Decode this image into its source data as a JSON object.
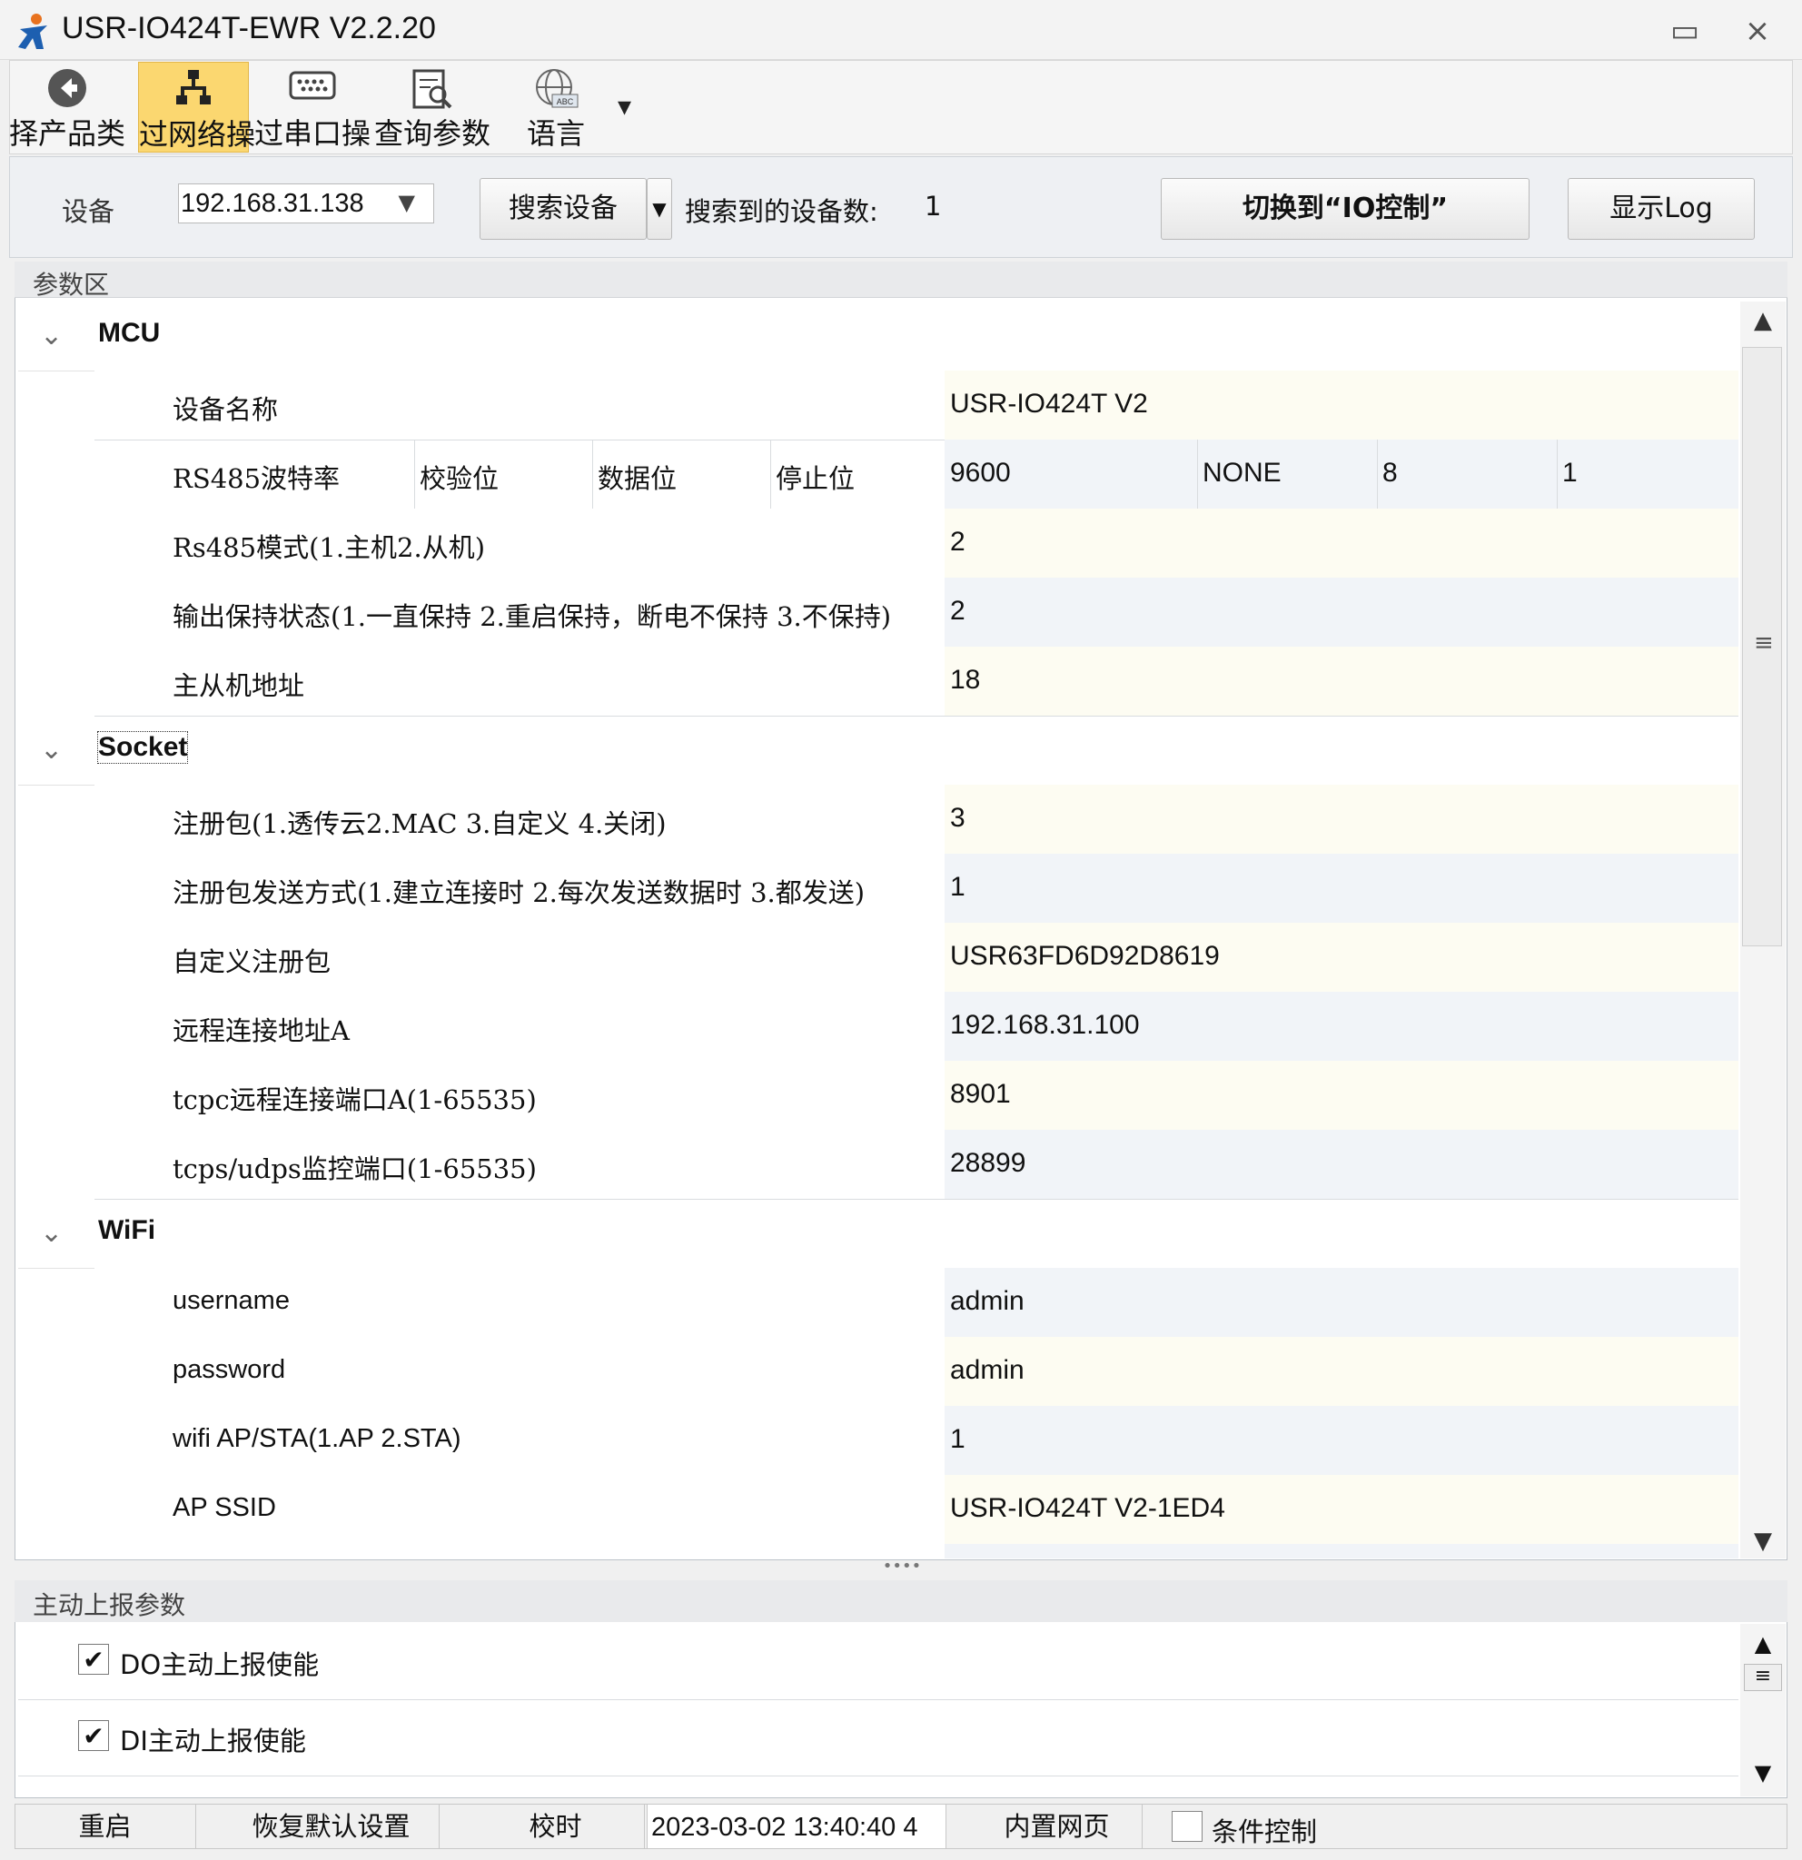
{
  "window": {
    "title": "USR-IO424T-EWR V2.2.20",
    "minimize_glyph": "▭",
    "close_glyph": "⨯"
  },
  "toolbar": {
    "items": [
      {
        "label": "择产品类",
        "icon": "back-arrow-icon"
      },
      {
        "label": "过网络操",
        "icon": "network-icon",
        "active": true
      },
      {
        "label": "过串口操",
        "icon": "serial-port-icon"
      },
      {
        "label": "查询参数",
        "icon": "query-params-icon"
      },
      {
        "label": "语言",
        "icon": "language-globe-icon"
      }
    ],
    "more_glyph": "▾"
  },
  "device_row": {
    "device_label": "设备",
    "device_ip": "192.168.31.138",
    "search_button": "搜索设备",
    "found_label": "搜索到的设备数:",
    "found_count": "1",
    "switch_button": "切换到“IO控制”",
    "log_button": "显示Log"
  },
  "params": {
    "header": "参数区",
    "mcu": {
      "title": "MCU",
      "device_name_label": "设备名称",
      "device_name_value": "USR-IO424T V2",
      "rs485": {
        "baud_label": "RS485波特率",
        "parity_label": "校验位",
        "databits_label": "数据位",
        "stopbits_label": "停止位",
        "baud": "9600",
        "parity": "NONE",
        "databits": "8",
        "stopbits": "1"
      },
      "mode_label": "Rs485模式(1.主机2.从机)",
      "mode_value": "2",
      "output_label": "输出保持状态(1.一直保持 2.重启保持，断电不保持 3.不保持)",
      "output_value": "2",
      "addr_label": "主从机地址",
      "addr_value": "18"
    },
    "socket": {
      "title": "Socket",
      "reg_label": "注册包(1.透传云2.MAC 3.自定义 4.关闭)",
      "reg_value": "3",
      "reg_send_label": "注册包发送方式(1.建立连接时 2.每次发送数据时 3.都发送)",
      "reg_send_value": "1",
      "custom_reg_label": "自定义注册包",
      "custom_reg_value": "USR63FD6D92D8619",
      "remote_addr_label": "远程连接地址A",
      "remote_addr_value": "192.168.31.100",
      "tcpc_port_label": "tcpc远程连接端口A(1-65535)",
      "tcpc_port_value": "8901",
      "listen_port_label": "tcps/udps监控端口(1-65535)",
      "listen_port_value": "28899"
    },
    "wifi": {
      "title": "WiFi",
      "username_label": "username",
      "username_value": "admin",
      "password_label": "password",
      "password_value": "admin",
      "mode_label": "wifi AP/STA(1.AP 2.STA)",
      "mode_value": "1",
      "ssid_label": "AP SSID",
      "ssid_value": "USR-IO424T V2-1ED4"
    }
  },
  "report": {
    "header": "主动上报参数",
    "do_label": "DO主动上报使能",
    "do_checked": true,
    "di_label": "DI主动上报使能",
    "di_checked": true
  },
  "statusbar": {
    "restart": "重启",
    "restore": "恢复默认设置",
    "timesync": "校时",
    "datetime": "2023-03-02 13:40:40 4",
    "webpage": "内置网页",
    "condition": "条件控制",
    "condition_checked": false
  },
  "colors": {
    "active_tool": "#fbd770",
    "value_yellow": "#fdfcf2",
    "value_blue": "#f1f4f8"
  }
}
